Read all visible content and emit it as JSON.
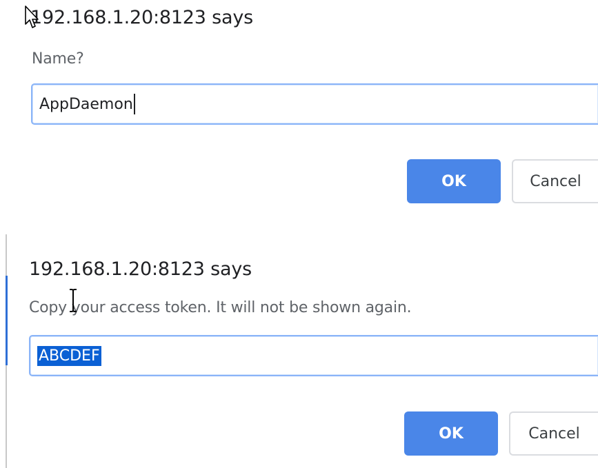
{
  "prompt_dialog": {
    "title": "192.168.1.20:8123 says",
    "message": "Name?",
    "input_value": "AppDaemon",
    "ok_label": "OK",
    "cancel_label": "Cancel"
  },
  "token_dialog": {
    "title": "192.168.1.20:8123 says",
    "message": "Copy your access token. It will not be shown again.",
    "input_value": "ABCDEF",
    "ok_label": "OK",
    "cancel_label": "Cancel"
  },
  "icons": [
    "arrow-cursor-icon",
    "ibeam-cursor-icon"
  ],
  "colors": {
    "ok_button": "#4a86e8",
    "input_focus_border": "#8ab4f8",
    "selection": "#0b60d4"
  }
}
